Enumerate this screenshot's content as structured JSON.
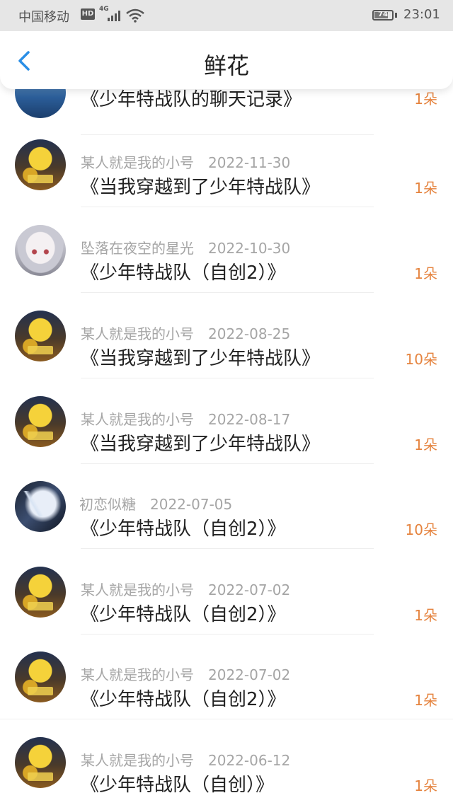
{
  "status_bar": {
    "carrier": "中国移动",
    "hd": "HD",
    "network": "4G",
    "battery": "74",
    "time": "23:01"
  },
  "header": {
    "title": "鲜花"
  },
  "records": [
    {
      "avatar": "sea-avatar",
      "user": "",
      "date": "",
      "title": "《少年特战队的聊天记录》",
      "amount": "1朵"
    },
    {
      "avatar": "pikachu-avatar",
      "user": "某人就是我的小号",
      "date": "2022-11-30",
      "title": "《当我穿越到了少年特战队》",
      "amount": "1朵"
    },
    {
      "avatar": "girl-avatar",
      "user": "坠落在夜空的星光",
      "date": "2022-10-30",
      "title": "《少年特战队（自创2）》",
      "amount": "1朵"
    },
    {
      "avatar": "pikachu-avatar",
      "user": "某人就是我的小号",
      "date": "2022-08-25",
      "title": "《当我穿越到了少年特战队》",
      "amount": "10朵"
    },
    {
      "avatar": "pikachu-avatar",
      "user": "某人就是我的小号",
      "date": "2022-08-17",
      "title": "《当我穿越到了少年特战队》",
      "amount": "1朵"
    },
    {
      "avatar": "angel-avatar",
      "user": "初恋似糖",
      "date": "2022-07-05",
      "title": "《少年特战队（自创2）》",
      "amount": "10朵"
    },
    {
      "avatar": "pikachu-avatar",
      "user": "某人就是我的小号",
      "date": "2022-07-02",
      "title": "《少年特战队（自创2）》",
      "amount": "1朵"
    },
    {
      "avatar": "pikachu-avatar",
      "user": "某人就是我的小号",
      "date": "2022-07-02",
      "title": "《少年特战队（自创2）》",
      "amount": "1朵"
    },
    {
      "avatar": "pikachu-avatar",
      "user": "某人就是我的小号",
      "date": "2022-06-12",
      "title": "《少年特战队（自创）》",
      "amount": "1朵"
    }
  ]
}
